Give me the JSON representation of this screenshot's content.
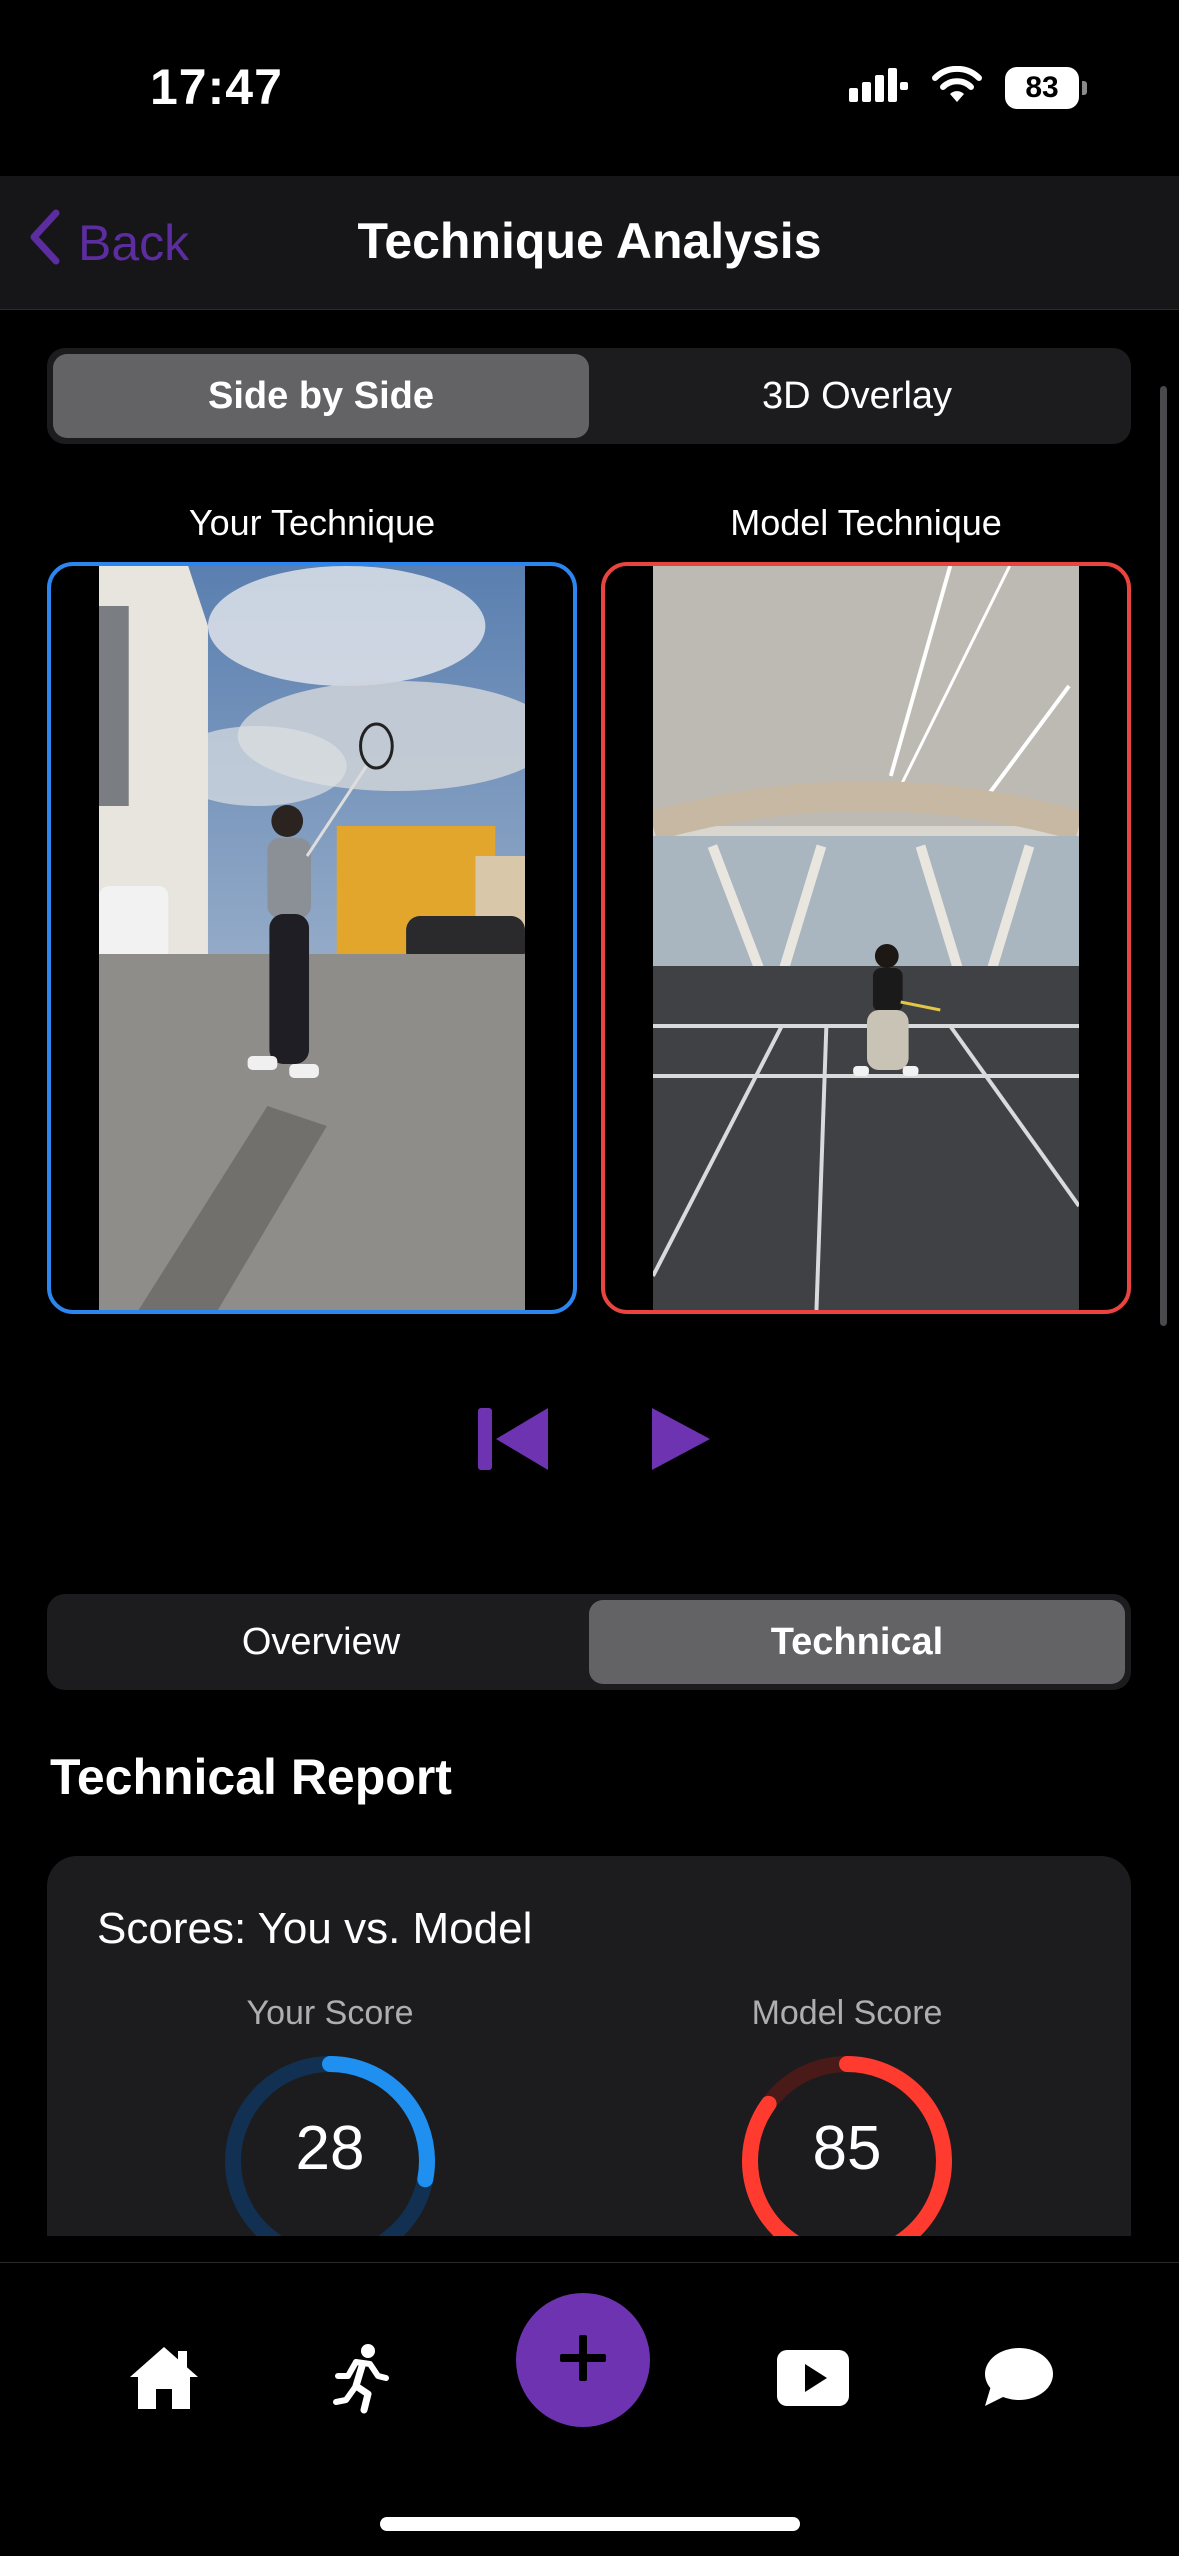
{
  "status_bar": {
    "time": "17:47",
    "battery": "83"
  },
  "nav": {
    "back_label": "Back",
    "title": "Technique Analysis"
  },
  "view_toggle": {
    "options": [
      "Side by Side",
      "3D Overlay"
    ],
    "selected": "Side by Side"
  },
  "videos": {
    "you_label": "Your Technique",
    "model_label": "Model Technique"
  },
  "report_tabs": {
    "options": [
      "Overview",
      "Technical"
    ],
    "selected": "Technical"
  },
  "report": {
    "title": "Technical Report",
    "scores_card": {
      "title": "Scores: You vs. Model",
      "your_label": "Your Score",
      "your_score": "28",
      "model_label": "Model Score",
      "model_score": "85"
    }
  },
  "colors": {
    "accent": "#6e33b0",
    "back": "#5b2d9e",
    "you": "#2c86f0",
    "model": "#e9443f"
  },
  "tab_bar": {
    "icons": [
      "home-icon",
      "running-icon",
      "plus-icon",
      "play-icon",
      "chat-bubble-icon"
    ]
  }
}
